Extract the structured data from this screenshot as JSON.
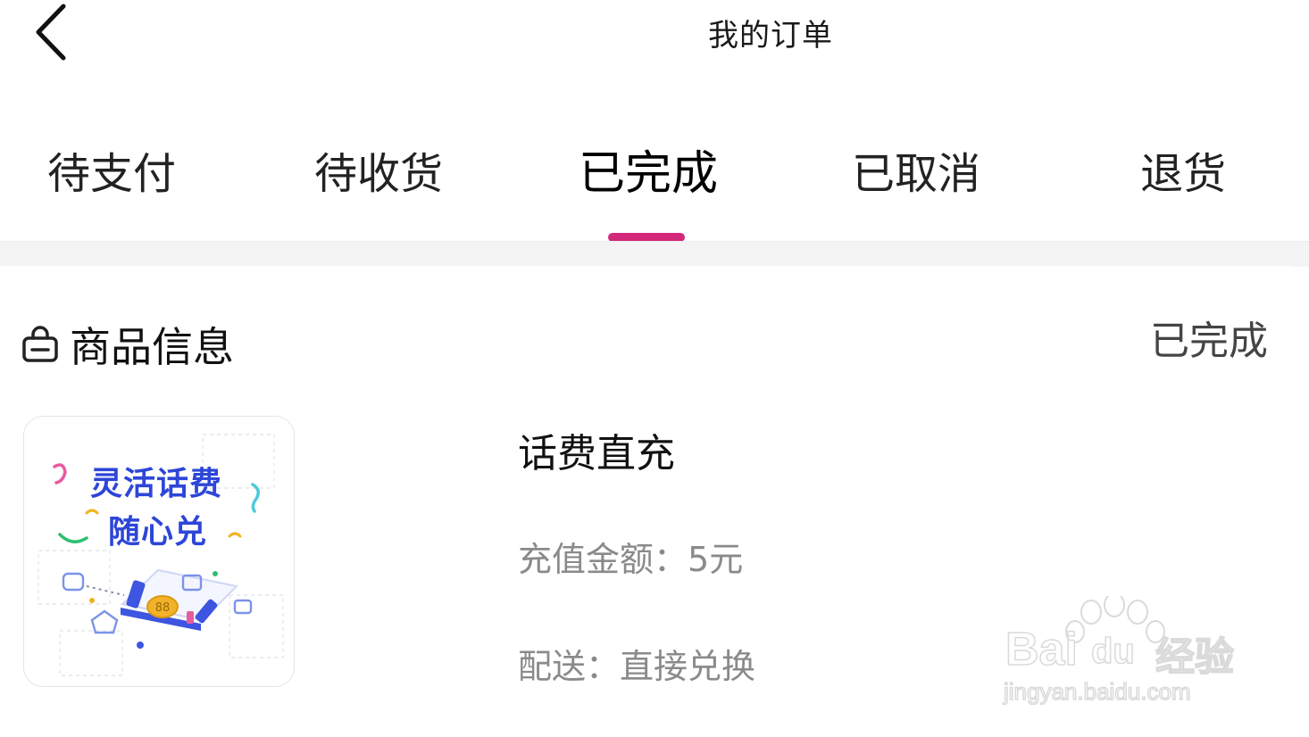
{
  "header": {
    "title": "我的订单"
  },
  "tabs": [
    {
      "label": "待支付"
    },
    {
      "label": "待收货"
    },
    {
      "label": "已完成"
    },
    {
      "label": "已取消"
    },
    {
      "label": "退货"
    }
  ],
  "active_tab_index": 2,
  "order": {
    "section_title": "商品信息",
    "status": "已完成",
    "product": {
      "name": "话费直充",
      "thumbnail_text_line1": "灵活话费",
      "thumbnail_text_line2": "随心兑",
      "amount_label": "充值金额：",
      "amount_value": "5元",
      "delivery_label": "配送：",
      "delivery_value": "直接兑换"
    }
  },
  "watermark": {
    "brand_left": "Bai",
    "brand_mid": "du",
    "brand_right": "经验",
    "url": "jingyan.baidu.com"
  },
  "colors": {
    "accent": "#d4287a",
    "thumbnail_text": "#2d46d8",
    "muted_text": "#8a8a8a"
  },
  "icons": {
    "back": "chevron-left-icon",
    "section": "shopping-bag-icon"
  }
}
